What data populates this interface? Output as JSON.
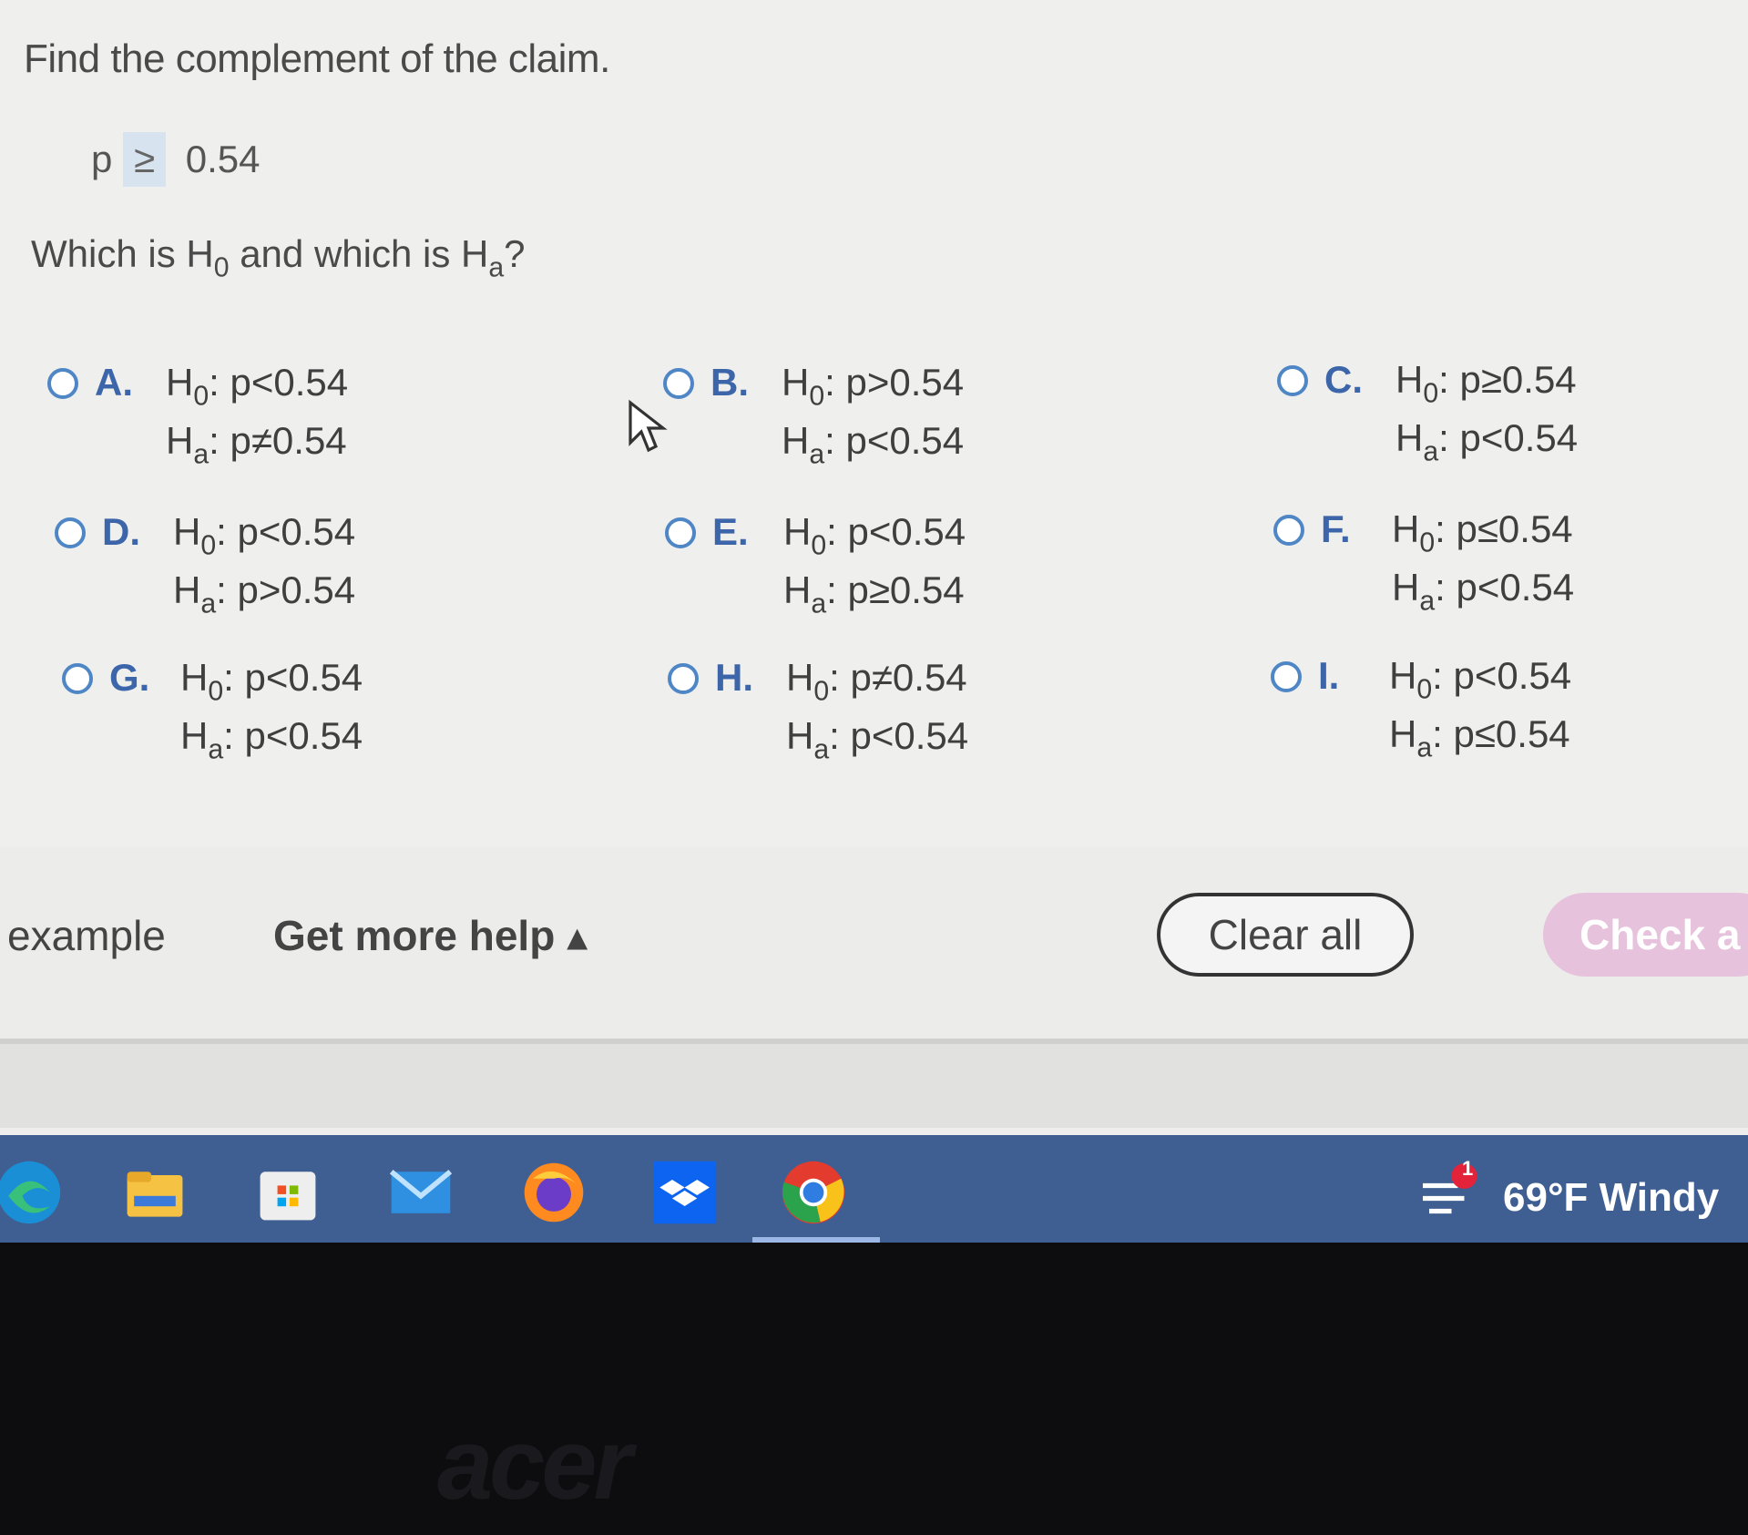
{
  "question": {
    "text": "Find the complement of the claim.",
    "claim_var": "p",
    "claim_symbol": "≥",
    "claim_value": "0.54",
    "prompt_prefix": "Which is H",
    "prompt_sub0": "0",
    "prompt_mid": " and which is H",
    "prompt_suba": "a",
    "prompt_suffix": "?"
  },
  "options": [
    {
      "letter": "A.",
      "h0": "p<0.54",
      "ha": "p≠0.54"
    },
    {
      "letter": "B.",
      "h0": "p>0.54",
      "ha": "p<0.54"
    },
    {
      "letter": "C.",
      "h0": "p≥0.54",
      "ha": "p<0.54"
    },
    {
      "letter": "D.",
      "h0": "p<0.54",
      "ha": "p>0.54"
    },
    {
      "letter": "E.",
      "h0": "p<0.54",
      "ha": "p≥0.54"
    },
    {
      "letter": "F.",
      "h0": "p≤0.54",
      "ha": "p<0.54"
    },
    {
      "letter": "G.",
      "h0": "p<0.54",
      "ha": "p<0.54"
    },
    {
      "letter": "H.",
      "h0": "p≠0.54",
      "ha": "p<0.54"
    },
    {
      "letter": "I.",
      "h0": "p<0.54",
      "ha": "p≤0.54"
    }
  ],
  "hypothesis": {
    "h": "H",
    "sub0": "0",
    "suba": "a",
    "sep": ": "
  },
  "footer": {
    "example": "example",
    "get_more_help": "Get more help ▴",
    "clear_all": "Clear all",
    "check_answer": "Check a"
  },
  "taskbar": {
    "icons": [
      "edge-icon",
      "file-explorer-icon",
      "store-icon",
      "mail-icon",
      "firefox-icon",
      "dropbox-icon",
      "chrome-icon"
    ],
    "weather": "69°F  Windy",
    "weather_badge": "1"
  },
  "bezel": {
    "brand": "acer"
  },
  "colors": {
    "accent": "#3c66a9",
    "radio": "#4f86c6",
    "taskbar": "#3f5f93",
    "check": "#e7c2dc"
  }
}
